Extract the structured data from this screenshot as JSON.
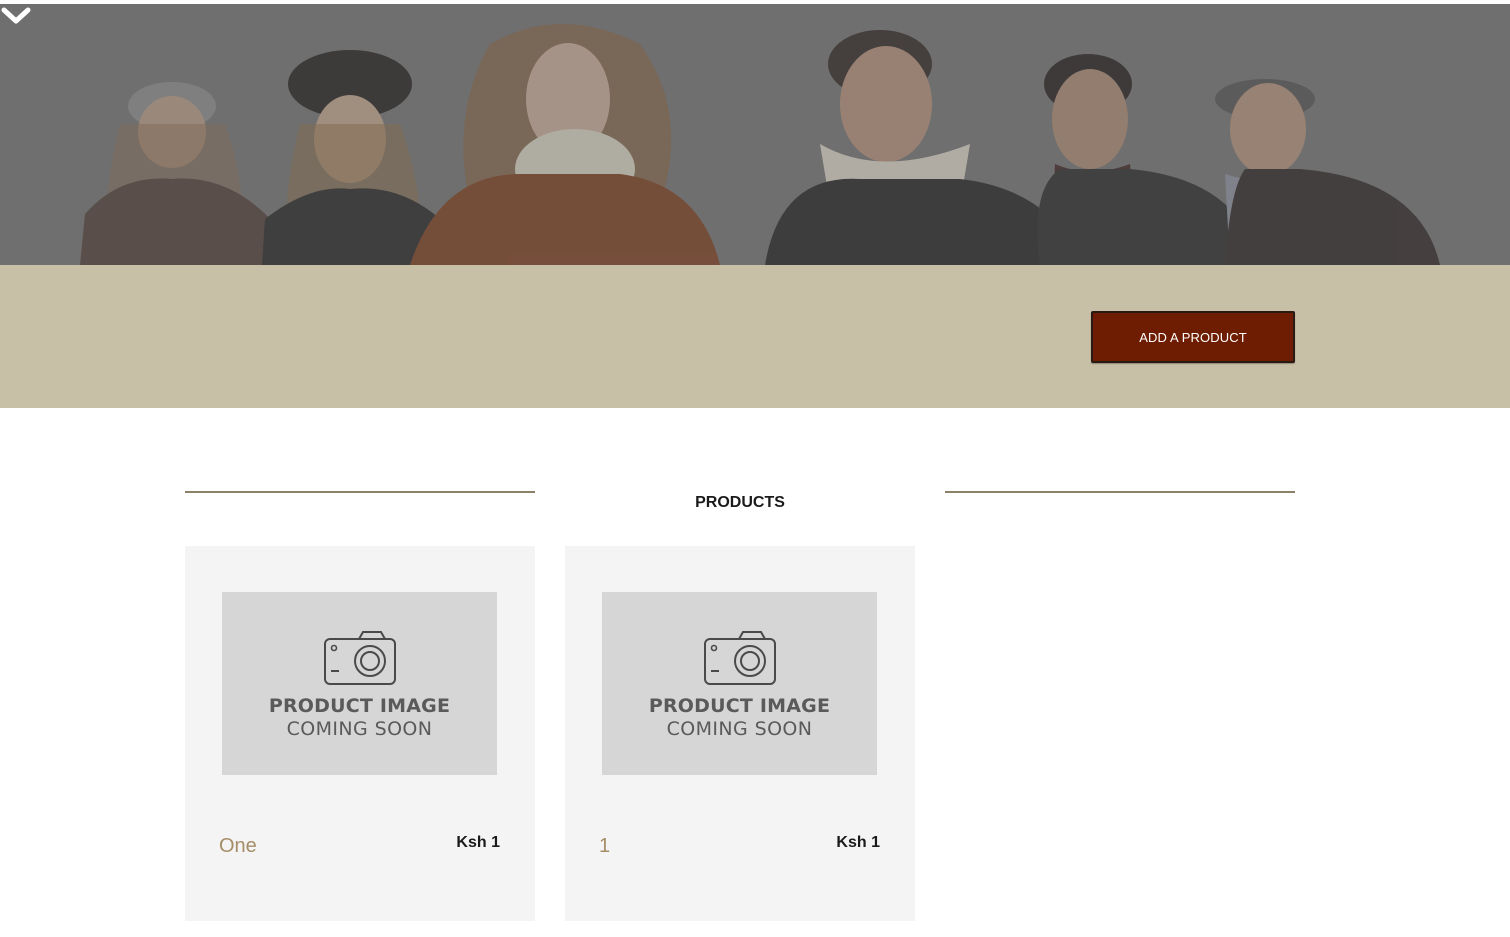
{
  "hero": {
    "chevron_icon": "chevron-down-icon"
  },
  "actions": {
    "add_product_label": "ADD A PRODUCT",
    "button_color": "#6e1c02"
  },
  "products_section": {
    "title": "PRODUCTS",
    "placeholder_line1": "PRODUCT IMAGE",
    "placeholder_line2": "COMING SOON",
    "items": [
      {
        "name": "One",
        "price": "Ksh 1"
      },
      {
        "name": "1",
        "price": "Ksh 1"
      }
    ]
  },
  "colors": {
    "band": "#c8bfa7",
    "rule": "#8d8267",
    "product_name": "#a58d67",
    "card_bg": "#f4f4f5"
  }
}
